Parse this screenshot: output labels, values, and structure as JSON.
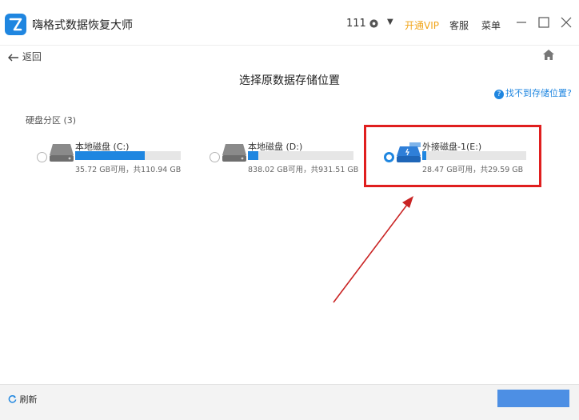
{
  "app": {
    "title": "嗨格式数据恢复大师",
    "user_count": "111",
    "vip_label": "开通VIP",
    "service_label": "客服",
    "menu_label": "菜单",
    "accent_color": "#1f86e0",
    "vip_color": "#f1a51a"
  },
  "nav": {
    "back_label": "返回",
    "home_icon": "home-icon"
  },
  "page": {
    "title": "选择原数据存储位置",
    "help_link": "找不到存储位置?",
    "section_label": "硬盘分区 (3)"
  },
  "drives": [
    {
      "name": "本地磁盘 (C:)",
      "size_text": "35.72 GB可用，共110.94 GB",
      "used_fraction": 0.66,
      "selected": false,
      "type": "local"
    },
    {
      "name": "本地磁盘 (D:)",
      "size_text": "838.02 GB可用，共931.51 GB",
      "used_fraction": 0.1,
      "selected": false,
      "type": "local"
    },
    {
      "name": "外接磁盘-1(E:)",
      "size_text": "28.47 GB可用，共29.59 GB",
      "used_fraction": 0.04,
      "selected": true,
      "type": "external"
    }
  ],
  "annotation": {
    "highlight_color": "#e01f1f"
  },
  "footer": {
    "refresh_label": "刷新"
  }
}
